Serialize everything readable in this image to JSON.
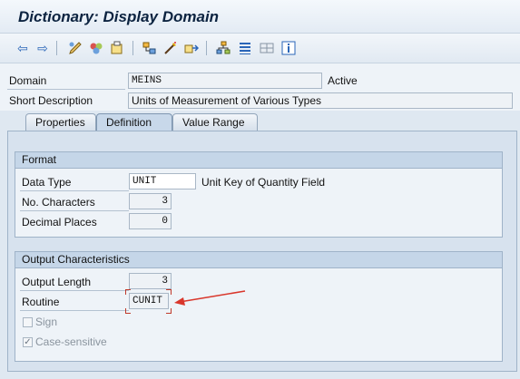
{
  "window": {
    "title": "Dictionary: Display Domain"
  },
  "toolbar": {
    "icons": [
      "back-arrow-icon",
      "forward-arrow-icon",
      "display-change-icon",
      "activate-icon",
      "other-object-icon",
      "hierarchy-icon",
      "where-used-icon",
      "object-list-icon",
      "tree-icon",
      "list-icon",
      "grid-icon",
      "info-icon"
    ]
  },
  "header": {
    "domain_label": "Domain",
    "domain_value": "MEINS",
    "status": "Active",
    "short_desc_label": "Short Description",
    "short_desc_value": "Units of Measurement of Various Types"
  },
  "tabs": [
    {
      "label": "Properties"
    },
    {
      "label": "Definition"
    },
    {
      "label": "Value Range"
    }
  ],
  "format": {
    "title": "Format",
    "data_type_label": "Data Type",
    "data_type_value": "UNIT",
    "data_type_desc": "Unit Key of Quantity Field",
    "no_chars_label": "No. Characters",
    "no_chars_value": "3",
    "decimal_label": "Decimal Places",
    "decimal_value": "0"
  },
  "output": {
    "title": "Output Characteristics",
    "length_label": "Output Length",
    "length_value": "3",
    "routine_label": "Routine",
    "routine_value": "CUNIT",
    "sign_label": "Sign",
    "sign_checked": false,
    "case_label": "Case-sensitive",
    "case_checked": true
  },
  "colors": {
    "accent": "#c0392b",
    "panel": "#d7e2ee",
    "group_header": "#c5d6e8"
  }
}
